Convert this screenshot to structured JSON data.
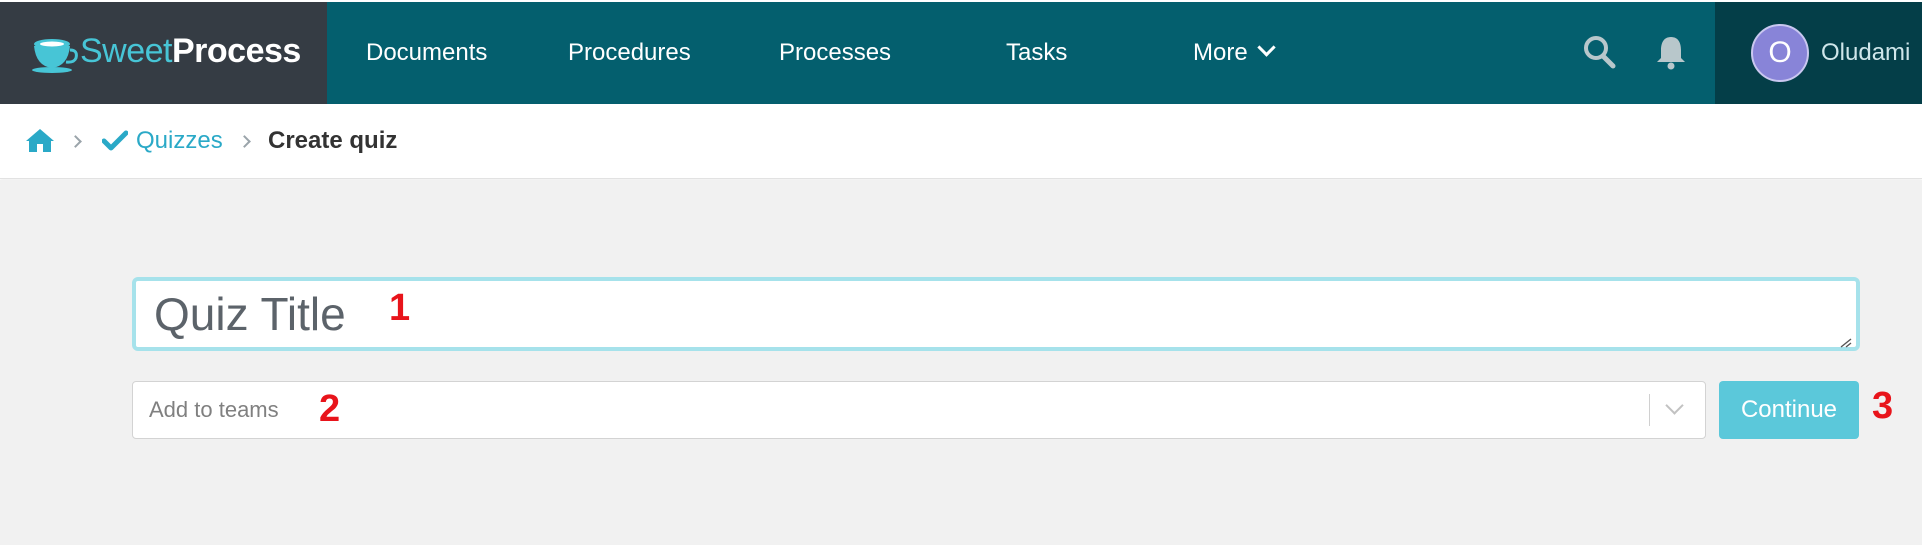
{
  "app": {
    "logo_sweet": "Sweet",
    "logo_process": "Process"
  },
  "nav": {
    "items": [
      "Documents",
      "Procedures",
      "Processes",
      "Tasks",
      "More"
    ],
    "icons": [
      "search-icon",
      "bell-icon"
    ],
    "user": {
      "avatar_initial": "O",
      "name": "Oludami"
    }
  },
  "breadcrumb": {
    "home_icon": "home-icon",
    "section_icon": "checkmark-icon",
    "section": "Quizzes",
    "current": "Create quiz"
  },
  "form": {
    "title_placeholder": "Quiz Title",
    "title_value": "",
    "teams_placeholder": "Add to teams",
    "continue_label": "Continue"
  },
  "annotations": [
    "1",
    "2",
    "3"
  ],
  "colors": {
    "logo_bg": "#353c44",
    "nav_bg": "#045f6e",
    "user_bg": "#043e48",
    "accent": "#2aa9c7",
    "continue_bg": "#5bc8da",
    "content_bg": "#f1f1f1",
    "annotation": "#e8141b"
  }
}
